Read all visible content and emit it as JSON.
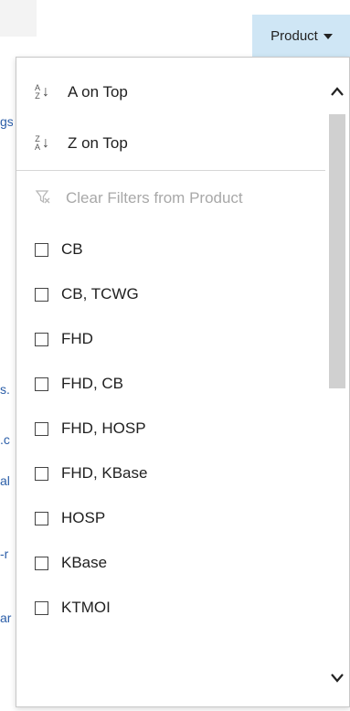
{
  "header": {
    "product_label": "Product"
  },
  "background_fragments": [
    {
      "text": "gs"
    },
    {
      "text": "s."
    },
    {
      "text": ".c"
    },
    {
      "text": "al"
    },
    {
      "text": "-r"
    },
    {
      "text": "ar"
    }
  ],
  "menu": {
    "sort_a_label": "A on Top",
    "sort_z_label": "Z on Top",
    "sort_a_icon": {
      "top": "A",
      "bottom": "Z"
    },
    "sort_z_icon": {
      "top": "Z",
      "bottom": "A"
    },
    "clear_filters_label": "Clear Filters from Product",
    "options": [
      {
        "label": "CB",
        "checked": false
      },
      {
        "label": "CB, TCWG",
        "checked": false
      },
      {
        "label": "FHD",
        "checked": false
      },
      {
        "label": "FHD, CB",
        "checked": false
      },
      {
        "label": "FHD, HOSP",
        "checked": false
      },
      {
        "label": "FHD, KBase",
        "checked": false
      },
      {
        "label": "HOSP",
        "checked": false
      },
      {
        "label": "KBase",
        "checked": false
      },
      {
        "label": "KTMOI",
        "checked": false
      }
    ]
  },
  "scrollbar": {
    "position_fraction": 0.0,
    "visible_fraction": 0.5
  },
  "colors": {
    "header_highlight": "#cfe6f5",
    "disabled_text": "#a8a8a8",
    "link_fragment": "#2b5ea8"
  }
}
